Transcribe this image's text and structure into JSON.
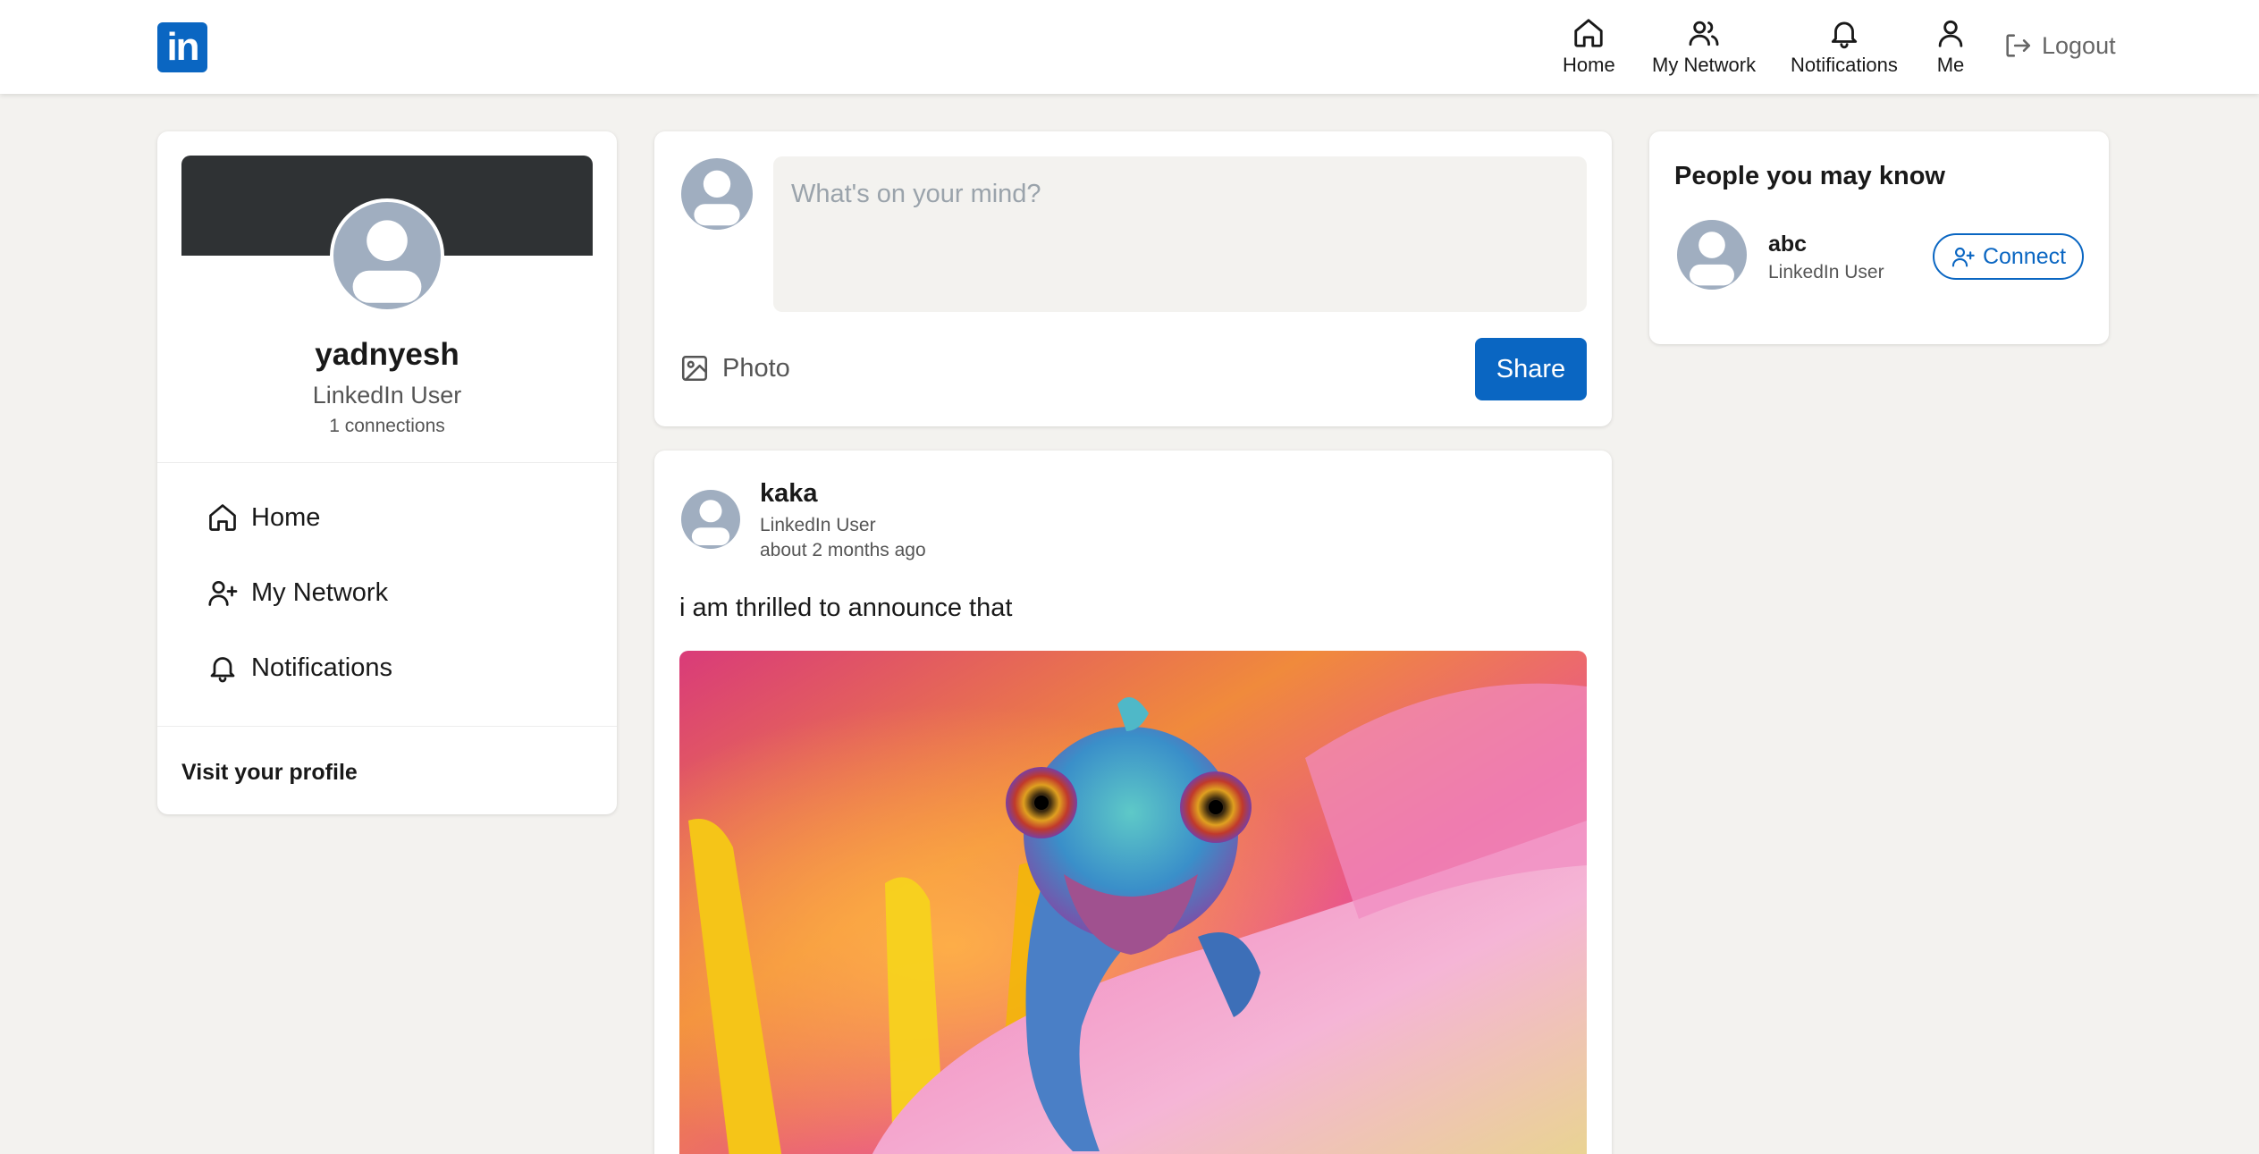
{
  "header": {
    "logo_text": "in",
    "nav": [
      {
        "label": "Home",
        "icon": "home-icon"
      },
      {
        "label": "My Network",
        "icon": "people-icon"
      },
      {
        "label": "Notifications",
        "icon": "bell-icon"
      },
      {
        "label": "Me",
        "icon": "user-icon"
      }
    ],
    "logout_label": "Logout"
  },
  "profile": {
    "name": "yadnyesh",
    "title": "LinkedIn User",
    "connections": "1 connections",
    "links": [
      {
        "label": "Home",
        "icon": "home-icon"
      },
      {
        "label": "My Network",
        "icon": "user-plus-icon"
      },
      {
        "label": "Notifications",
        "icon": "bell-icon"
      }
    ],
    "visit_label": "Visit your profile"
  },
  "composer": {
    "placeholder": "What's on your mind?",
    "value": "",
    "photo_label": "Photo",
    "share_label": "Share"
  },
  "posts": [
    {
      "author": "kaka",
      "subtitle": "LinkedIn User",
      "time": "about 2 months ago",
      "text": "i am thrilled to announce that",
      "image": "chameleon-on-pink-flower"
    }
  ],
  "suggestions": {
    "title": "People you may know",
    "people": [
      {
        "name": "abc",
        "subtitle": "LinkedIn User",
        "action_label": "Connect"
      }
    ]
  },
  "colors": {
    "brand": "#0a66c2",
    "background": "#f3f2ef",
    "avatar": "#a0aec0",
    "banner": "#2f3234"
  }
}
